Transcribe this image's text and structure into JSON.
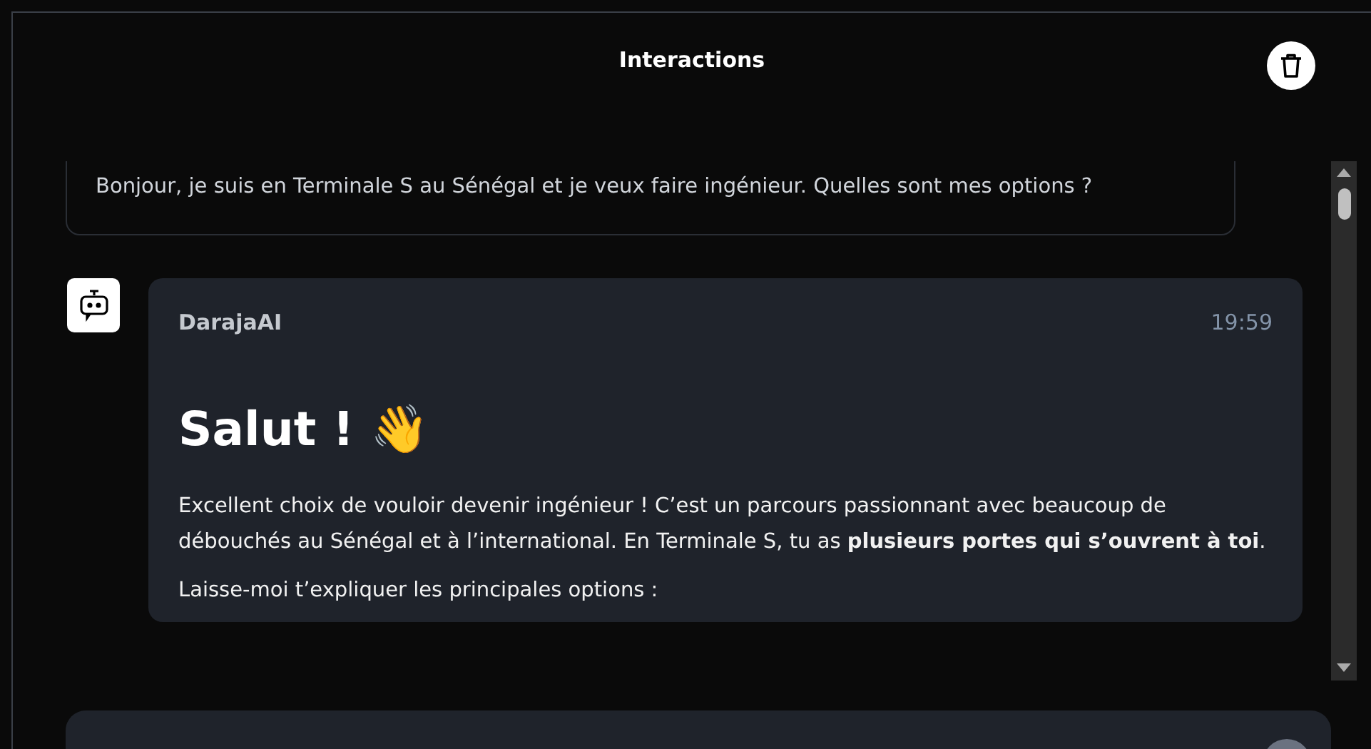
{
  "header": {
    "title": "Interactions"
  },
  "messages": [
    {
      "kind": "user",
      "paragraphs": [
        "Bonjour, je suis en Terminale S au Sénégal et je veux faire ingénieur. Quelles sont mes options ?"
      ]
    },
    {
      "kind": "bot",
      "author": "DarajaAI",
      "time": "19:59",
      "heading": "Salut ! 👋",
      "paragraphs": [
        "Excellent choix de vouloir devenir ingénieur ! C’est un parcours passionnant avec beaucoup de débouchés au Sénégal et à l’international. En Terminale S, tu as **plusieurs portes qui s’ouvrent à toi**.",
        "Laisse-moi t’expliquer les principales options :"
      ]
    }
  ]
}
